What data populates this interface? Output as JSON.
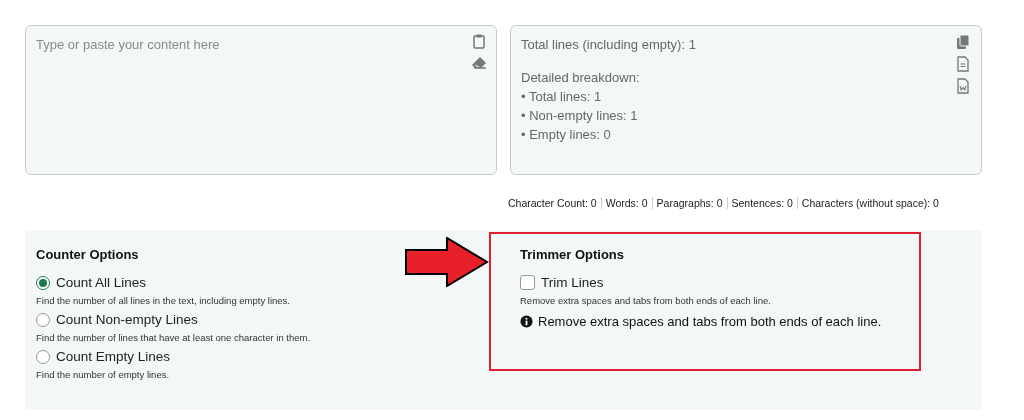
{
  "input": {
    "placeholder": "Type or paste your content here"
  },
  "output": {
    "paragraphs": [
      [
        "Total lines (including empty): 1"
      ],
      [
        "Detailed breakdown:",
        "• Total lines: 1",
        "• Non-empty lines: 1",
        "• Empty lines: 0"
      ]
    ]
  },
  "stats": [
    "Character Count: 0",
    "Words: 0",
    "Paragraphs: 0",
    "Sentences: 0",
    "Characters (without space): 0"
  ],
  "counter_options": {
    "title": "Counter Options",
    "options": [
      {
        "label": "Count All Lines",
        "description": "Find the number of all lines in the text, including empty lines.",
        "selected": true
      },
      {
        "label": "Count Non-empty Lines",
        "description": "Find the number of lines that have at least one character in them.",
        "selected": false
      },
      {
        "label": "Count Empty Lines",
        "description": "Find the number of empty lines.",
        "selected": false
      }
    ]
  },
  "trimmer_options": {
    "title": "Trimmer Options",
    "options": [
      {
        "label": "Trim Lines",
        "description": "Remove extra spaces and tabs from both ends of each line.",
        "checked": false
      }
    ],
    "info": "Remove extra spaces and tabs from both ends of each line."
  }
}
